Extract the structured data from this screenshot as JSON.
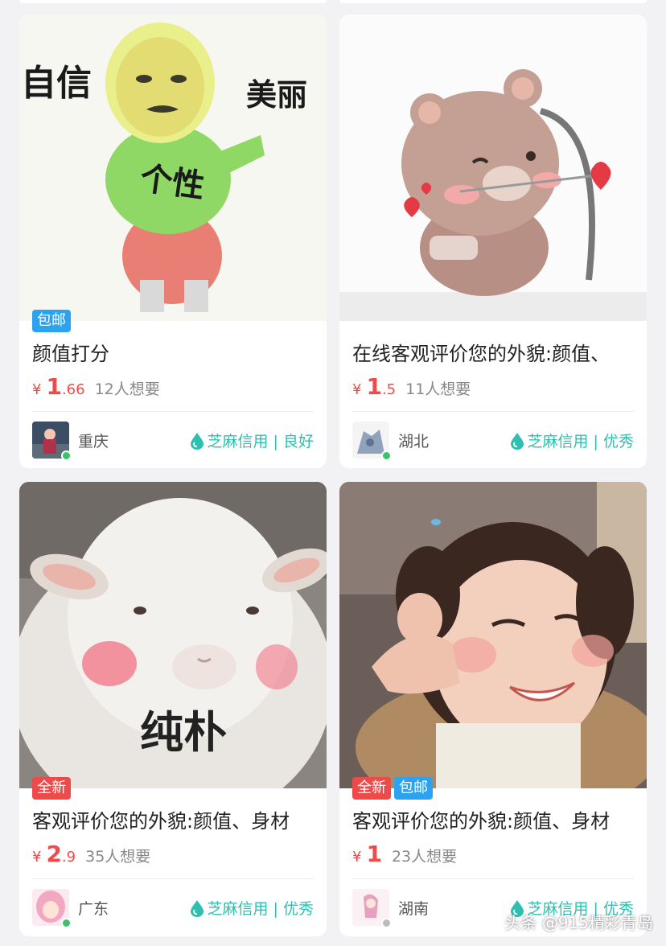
{
  "colors": {
    "price": "#f04a4a",
    "credit": "#2ebfb0",
    "tag_mail": "#2ba3f2",
    "tag_new": "#ef4a4a",
    "online": "#3cc36a"
  },
  "items": [
    {
      "image_text": [
        "自信",
        "美丽",
        "个性"
      ],
      "tags": [
        "包邮"
      ],
      "title": "颜值打分",
      "yen": "¥",
      "price_int": "1",
      "price_dec": ".66",
      "wants": "12人想要",
      "region": "重庆",
      "credit": "芝麻信用 | 良好",
      "online": true
    },
    {
      "image_text": [],
      "tags": [],
      "title": "在线客观评价您的外貌:颜值、",
      "yen": "¥",
      "price_int": "1",
      "price_dec": ".5",
      "wants": "11人想要",
      "region": "湖北",
      "credit": "芝麻信用 | 优秀",
      "online": true
    },
    {
      "image_text": [
        "纯朴"
      ],
      "tags": [
        "全新"
      ],
      "title": "客观评价您的外貌:颜值、身材",
      "yen": "¥",
      "price_int": "2",
      "price_dec": ".9",
      "wants": "35人想要",
      "region": "广东",
      "credit": "芝麻信用 | 优秀",
      "online": true
    },
    {
      "image_text": [],
      "tags": [
        "全新",
        "包邮"
      ],
      "title": "客观评价您的外貌:颜值、身材",
      "yen": "¥",
      "price_int": "1",
      "price_dec": "",
      "wants": "23人想要",
      "region": "湖南",
      "credit": "芝麻信用 | 优秀",
      "online": false
    }
  ],
  "watermark": "头条 @915精彩青岛"
}
